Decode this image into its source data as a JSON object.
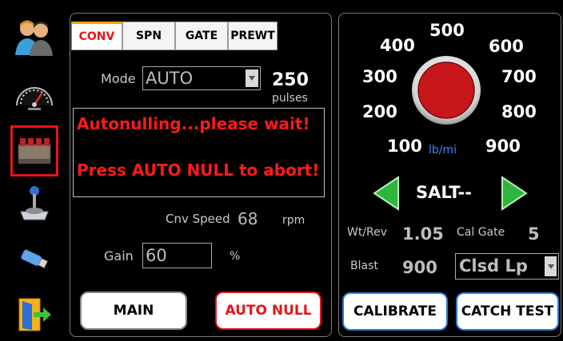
{
  "sidebar": {
    "items": [
      {
        "name": "users"
      },
      {
        "name": "speedometer"
      },
      {
        "name": "valve-manifold",
        "active": true
      },
      {
        "name": "joystick"
      },
      {
        "name": "usb-drive"
      },
      {
        "name": "exit"
      }
    ]
  },
  "tabs": [
    "CONV",
    "SPN",
    "GATE",
    "PREWT"
  ],
  "conveyor": {
    "mode_label": "Mode",
    "mode_value": "AUTO",
    "pulses_value": "250",
    "pulses_unit": "pulses",
    "message_line1": "Autonulling...please wait!",
    "message_line2": "Press AUTO NULL to abort!",
    "cnv_speed_label": "Cnv Speed",
    "cnv_speed_value": "68",
    "cnv_speed_unit": "rpm",
    "gain_label": "Gain",
    "gain_value": "60",
    "gain_unit": "%"
  },
  "buttons": {
    "main": "MAIN",
    "auto_null": "AUTO NULL",
    "calibrate": "CALIBRATE",
    "catch_test": "CATCH TEST"
  },
  "dial": {
    "labels": [
      "100",
      "200",
      "300",
      "400",
      "500",
      "600",
      "700",
      "800",
      "900"
    ],
    "unit": "lb/mi",
    "knob_color": "#c8171b"
  },
  "material": {
    "name": "SALT--"
  },
  "stats": {
    "wt_rev_label": "Wt/Rev",
    "wt_rev_value": "1.05",
    "cal_gate_label": "Cal Gate",
    "cal_gate_value": "5",
    "blast_label": "Blast",
    "blast_value": "900",
    "loop_value": "Clsd Lp"
  },
  "colors": {
    "accent_red": "#e8141a",
    "arrow_green": "#2fb53d",
    "unit_blue": "#2a8cff"
  }
}
